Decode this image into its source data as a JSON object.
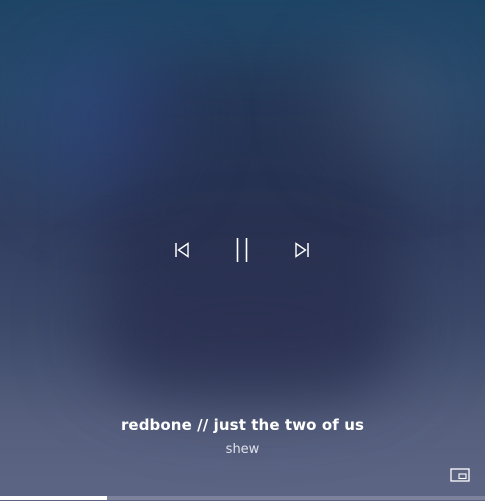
{
  "track": {
    "title": "redbone // just the two of us",
    "artist": "shew"
  },
  "controls": {
    "previous_icon": "skip-previous-icon",
    "pause_icon": "pause-icon",
    "next_icon": "skip-next-icon"
  },
  "miniplayer_icon": "compact-overlay-icon",
  "progress": {
    "fraction": 0.22
  },
  "colors": {
    "text": "#ffffff",
    "subtext": "#dfe2ea",
    "progress_fill": "#ffffff",
    "progress_track": "#8f94a8"
  }
}
